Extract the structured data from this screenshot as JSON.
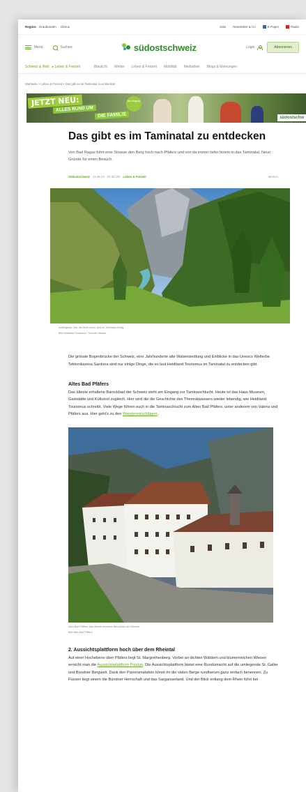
{
  "topbar": {
    "region_label": "Region:",
    "regions": [
      "Graubünden",
      "Glarus"
    ],
    "links": [
      "Jobs",
      "Newsletter & Co",
      "E-Paper",
      "Radio"
    ]
  },
  "header": {
    "menu_label": "Menü",
    "search_label": "Suchen",
    "logo_text": "südostschweiz",
    "login_label": "Login",
    "subscribe_label": "Abonnieren"
  },
  "nav": {
    "items": [
      "Schweiz & Welt",
      "Leben & Freizeit",
      "Blaulicht",
      "Wetter",
      "Leben & Freizeit",
      "Mobilität",
      "Mediathek",
      "Blogs & Meinungen"
    ]
  },
  "breadcrumb": {
    "items": [
      "Startseite",
      "Leben & Freizeit",
      "Das gibt es im Taminatal zu entdecken"
    ]
  },
  "banner": {
    "line1": "JETZT NEU:",
    "line2": "ALLES RUND UM",
    "line3": "DIE FAMILIE",
    "badge": "Neu Magazin",
    "logo": "südostschw"
  },
  "article": {
    "title": "Das gibt es im Taminatal zu entdecken",
    "lead": "Von Bad Ragaz führt eine Strasse den Berg hoch nach Pfäfers und von da immer tiefer hinein in das Taminatal. Neun Gründe für einen Besuch.",
    "source": "Südostschweiz",
    "date": "22.06.23 - 04:30 Uhr",
    "category": "Leben & Freizeit",
    "bookmark": "Merken",
    "image1_caption": "Ausflugsziel: Wer die Ruhe sucht, wird im Taminatal fündig.",
    "image1_credit": "Bild Heidiland Tourismus / Thomas Hassler",
    "intro": "Die grösste Bogenbrücke der Schweiz, eine Jahrhunderte alte Walsersiedlung und Einblicke in das Unesco Welterbe Tektonikarena Sardona sind nur einige Dinge, die es laut Heidiland Tourismus im Taminatal zu entdecken gibt.",
    "section1_title": "Altes Bad Pfäfers",
    "section1_text": "Das älteste erhaltene Barockbad der Schweiz steht am Eingang zur Taminaschlucht. Heute ist das Haus Museum, Gaststätte und Kulturort zugleich. Hier wird die die Geschichte des Thermalwassers wieder lebendig, wie Heidiland Tourismus schreibt. Viele Wege führen euch in die Taminaschlucht zum Alten Bad Pfäfers, unter anderem von Valens und Pfäfers aus. Hier geht's zu den",
    "section1_link": "Wandervorschlägen",
    "image2_caption": "Altes Bad Pfäfers: Das älteste erhaltene Barockbad der Schweiz.",
    "image2_credit": "Bild Altes Bad Pfäfers",
    "section2_title": "2. Aussichtsplattform hoch über dem Rheintal",
    "section2_text_a": "Auf einer Hochebene über Pfäfers liegt St. Margrethenberg. Vorbei an dichten Wäldern und blumenreichen Wiesen erreicht man die",
    "section2_link": "Aussichtsplattform Pizalun",
    "section2_text_b": ". Die Aussichtsplattform bietet eine Rundumsicht auf die umliegende St. Galler und Bündner Bergwelt. Dank den Panoramatafeln könnt ihr die vielen Berge rundherum ganz einfach benennen. Zu Füssen liegt einem die Bündner Herrschaft und das Sarganserland. Und der Blick entlang dem Rhein führt bei"
  },
  "colors": {
    "brand_green": "#2f8c2a",
    "accent_green": "#6aa72a",
    "subscribe_bg": "#e4efcf"
  }
}
